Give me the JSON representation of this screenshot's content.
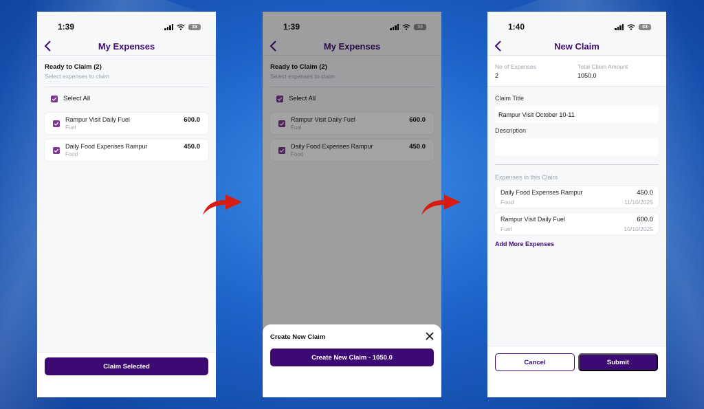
{
  "colors": {
    "brand": "#3d0a74",
    "checkbox": "#7a3a92",
    "arrow": "#d81c12",
    "background": "#1d63c9"
  },
  "screen1": {
    "time": "1:39",
    "battery": "33",
    "title": "My Expenses",
    "section_title": "Ready to Claim (2)",
    "section_subtitle": "Select expenses to claim",
    "select_all": "Select All",
    "expenses": [
      {
        "name": "Rampur Visit Daily Fuel",
        "category": "Fuel",
        "amount": "600.0"
      },
      {
        "name": "Daily Food Expenses Rampur",
        "category": "Food",
        "amount": "450.0"
      }
    ],
    "claim_button": "Claim Selected"
  },
  "screen2": {
    "time": "1:39",
    "battery": "33",
    "title": "My Expenses",
    "section_title": "Ready to Claim (2)",
    "section_subtitle": "Select expenses to claim",
    "select_all": "Select All",
    "expenses": [
      {
        "name": "Rampur Visit Daily Fuel",
        "category": "Fuel",
        "amount": "600.0"
      },
      {
        "name": "Daily Food Expenses Rampur",
        "category": "Food",
        "amount": "450.0"
      }
    ],
    "sheet_title": "Create New Claim",
    "sheet_button": "Create New Claim - 1050.0"
  },
  "screen3": {
    "time": "1:40",
    "battery": "33",
    "title": "New Claim",
    "no_of_expenses_label": "No of Expenses",
    "no_of_expenses_value": "2",
    "total_amount_label": "Total Claim Amount",
    "total_amount_value": "1050.0",
    "claim_title_label": "Claim Title",
    "claim_title_value": "Rampur Visit October 10-11",
    "description_label": "Description",
    "description_value": "",
    "expenses_label": "Expenses in this Claim",
    "expenses": [
      {
        "name": "Daily Food Expenses Rampur",
        "category": "Food",
        "amount": "450.0",
        "date": "11/10/2025"
      },
      {
        "name": "Rampur Visit Daily Fuel",
        "category": "Fuel",
        "amount": "600.0",
        "date": "10/10/2025"
      }
    ],
    "add_more": "Add More Expenses",
    "cancel": "Cancel",
    "submit": "Submit"
  }
}
